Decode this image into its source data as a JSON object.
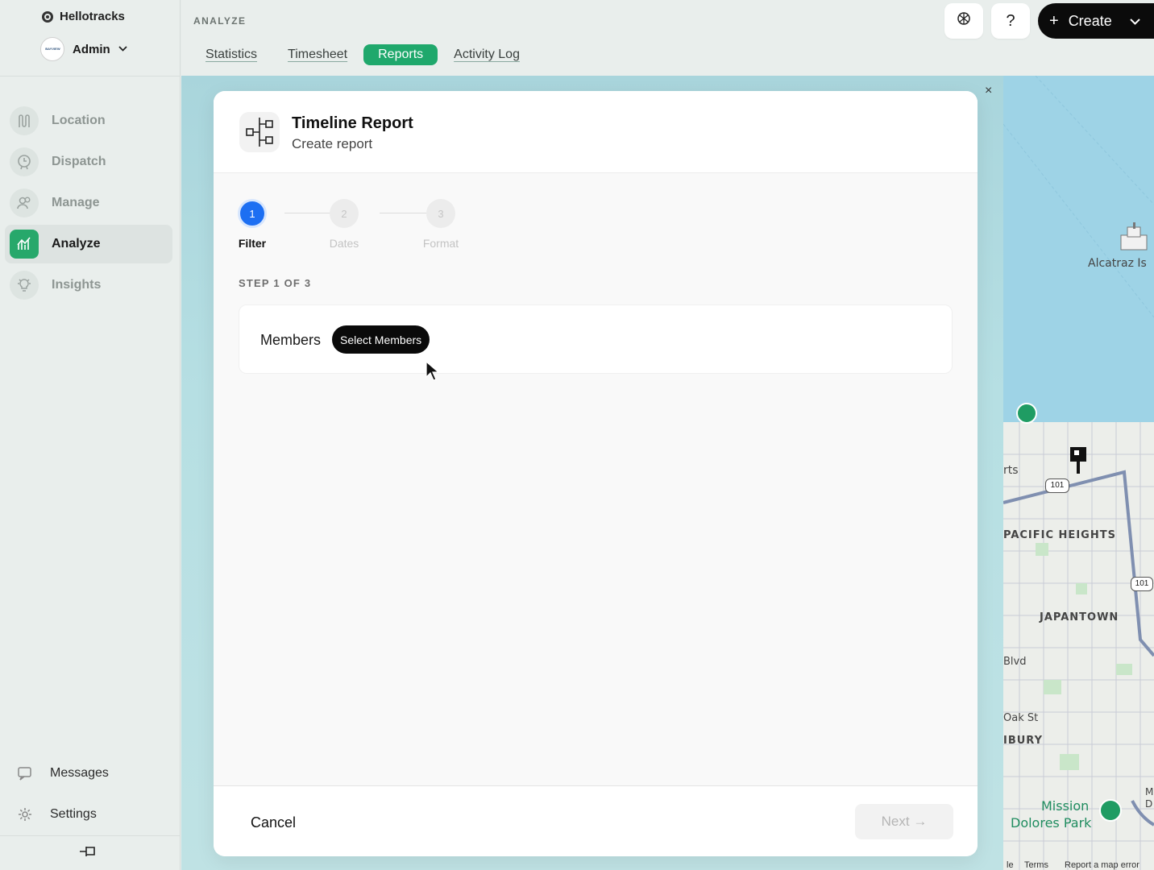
{
  "brand": {
    "name": "Hellotracks"
  },
  "account": {
    "name": "Admin",
    "avatar_text": "BAYVIEW"
  },
  "nav": {
    "items": [
      {
        "label": "Location",
        "icon": "location-route-icon"
      },
      {
        "label": "Dispatch",
        "icon": "dispatch-clock-icon"
      },
      {
        "label": "Manage",
        "icon": "manage-users-icon"
      },
      {
        "label": "Analyze",
        "icon": "analyze-chart-icon",
        "active": true
      },
      {
        "label": "Insights",
        "icon": "lightbulb-icon"
      }
    ],
    "bottom": [
      {
        "label": "Messages",
        "icon": "messages-icon"
      },
      {
        "label": "Settings",
        "icon": "gear-icon"
      }
    ]
  },
  "header": {
    "section": "ANALYZE",
    "tabs": [
      {
        "label": "Statistics"
      },
      {
        "label": "Timesheet"
      },
      {
        "label": "Reports",
        "active": true
      },
      {
        "label": "Activity Log"
      }
    ],
    "help_label": "?",
    "create_label": "Create"
  },
  "modal": {
    "title": "Timeline Report",
    "subtitle": "Create report",
    "close_label": "×",
    "steps": [
      {
        "number": "1",
        "label": "Filter",
        "active": true
      },
      {
        "number": "2",
        "label": "Dates"
      },
      {
        "number": "3",
        "label": "Format"
      }
    ],
    "step_caption": "STEP 1 OF 3",
    "filter": {
      "label": "Members",
      "button": "Select Members"
    },
    "cancel_label": "Cancel",
    "next_label": "Next →"
  },
  "map": {
    "labels": [
      "Alcatraz Is",
      "rts",
      "PACIFIC HEIGHTS",
      "JAPANTOWN",
      "Blvd",
      "Oak St",
      "IBURY",
      "Mission",
      "Dolores Park",
      "M",
      "D"
    ],
    "shields": [
      "101",
      "101"
    ],
    "footer": [
      "le",
      "Terms",
      "Report a map error"
    ]
  },
  "colors": {
    "accent_green": "#1fa86c",
    "step_blue": "#1d6ff2",
    "dark": "#0b0b0b"
  }
}
